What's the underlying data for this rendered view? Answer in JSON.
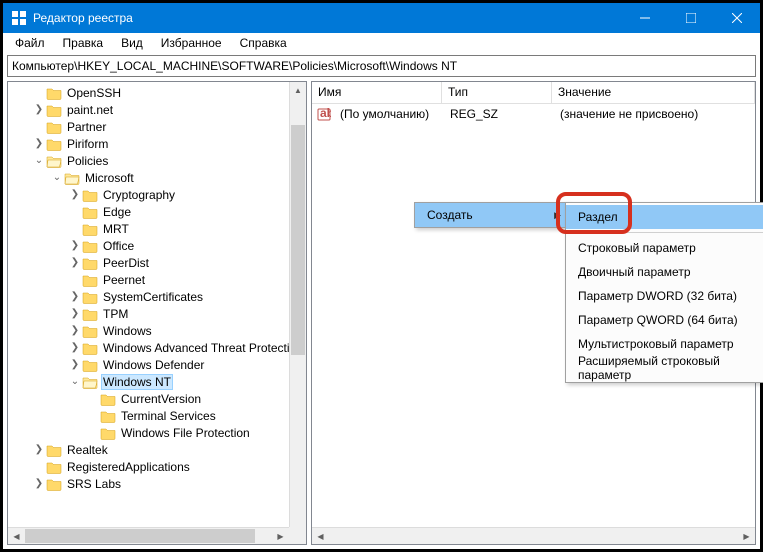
{
  "window": {
    "title": "Редактор реестра"
  },
  "menu": {
    "file": "Файл",
    "edit": "Правка",
    "view": "Вид",
    "favorites": "Избранное",
    "help": "Справка"
  },
  "address": "Компьютер\\HKEY_LOCAL_MACHINE\\SOFTWARE\\Policies\\Microsoft\\Windows NT",
  "columns": {
    "name": "Имя",
    "type": "Тип",
    "value": "Значение"
  },
  "default_value": {
    "name": "(По умолчанию)",
    "type": "REG_SZ",
    "value": "(значение не присвоено)"
  },
  "tree": [
    {
      "label": "OpenSSH",
      "depth": 1,
      "exp": ""
    },
    {
      "label": "paint.net",
      "depth": 1,
      "exp": ">"
    },
    {
      "label": "Partner",
      "depth": 1,
      "exp": ""
    },
    {
      "label": "Piriform",
      "depth": 1,
      "exp": ">"
    },
    {
      "label": "Policies",
      "depth": 1,
      "exp": "v",
      "open": true
    },
    {
      "label": "Microsoft",
      "depth": 2,
      "exp": "v",
      "open": true
    },
    {
      "label": "Cryptography",
      "depth": 3,
      "exp": ">"
    },
    {
      "label": "Edge",
      "depth": 3,
      "exp": ""
    },
    {
      "label": "MRT",
      "depth": 3,
      "exp": ""
    },
    {
      "label": "Office",
      "depth": 3,
      "exp": ">"
    },
    {
      "label": "PeerDist",
      "depth": 3,
      "exp": ">"
    },
    {
      "label": "Peernet",
      "depth": 3,
      "exp": ""
    },
    {
      "label": "SystemCertificates",
      "depth": 3,
      "exp": ">"
    },
    {
      "label": "TPM",
      "depth": 3,
      "exp": ">"
    },
    {
      "label": "Windows",
      "depth": 3,
      "exp": ">"
    },
    {
      "label": "Windows Advanced Threat Protection",
      "depth": 3,
      "exp": ">"
    },
    {
      "label": "Windows Defender",
      "depth": 3,
      "exp": ">"
    },
    {
      "label": "Windows NT",
      "depth": 3,
      "exp": "v",
      "open": true,
      "selected": true
    },
    {
      "label": "CurrentVersion",
      "depth": 4,
      "exp": ""
    },
    {
      "label": "Terminal Services",
      "depth": 4,
      "exp": ""
    },
    {
      "label": "Windows File Protection",
      "depth": 4,
      "exp": ""
    },
    {
      "label": "Realtek",
      "depth": 1,
      "exp": ">"
    },
    {
      "label": "RegisteredApplications",
      "depth": 1,
      "exp": ""
    },
    {
      "label": "SRS Labs",
      "depth": 1,
      "exp": ">"
    }
  ],
  "context": {
    "parent": "Создать",
    "submenu": [
      "Раздел",
      "Строковый параметр",
      "Двоичный параметр",
      "Параметр DWORD (32 бита)",
      "Параметр QWORD (64 бита)",
      "Мультистроковый параметр",
      "Расширяемый строковый параметр"
    ]
  }
}
